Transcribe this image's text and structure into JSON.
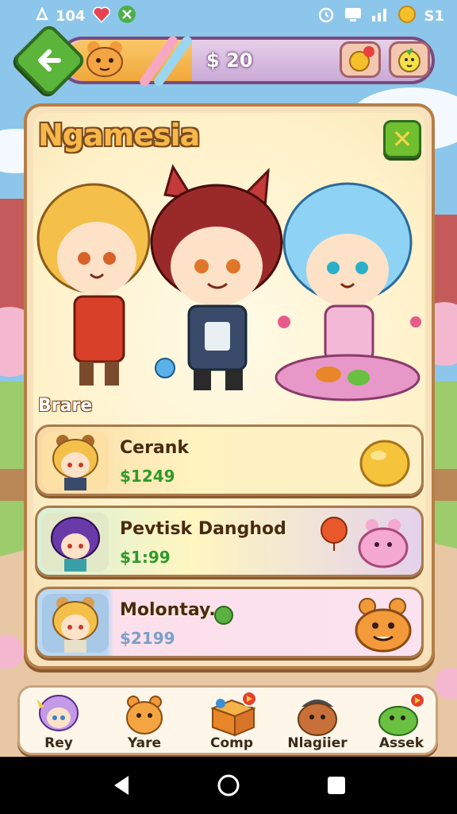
{
  "status_bar": {
    "left_text": "104",
    "right_text": "S1"
  },
  "top_bar": {
    "currency_value": "$ 20"
  },
  "panel": {
    "title": "Ngamesia",
    "section_label": "Brare"
  },
  "offers": [
    {
      "name": "Cerank",
      "price": "$1249",
      "price_color": "#2f9a2a"
    },
    {
      "name": "Pevtisk Danghod",
      "price": "$1:99",
      "price_color": "#2f9a2a"
    },
    {
      "name": "Molontay.",
      "price": "$2199",
      "price_color": "#7aa0c8"
    }
  ],
  "bottom_nav": [
    {
      "label": "Rey"
    },
    {
      "label": "Yare"
    },
    {
      "label": "Comp"
    },
    {
      "label": "Nlagiier"
    },
    {
      "label": "Assek"
    }
  ],
  "colors": {
    "accent_green": "#5bb53a",
    "panel_brown": "#b67e48",
    "bar_purple": "#c9a9d6",
    "gold": "#f7b84a"
  }
}
